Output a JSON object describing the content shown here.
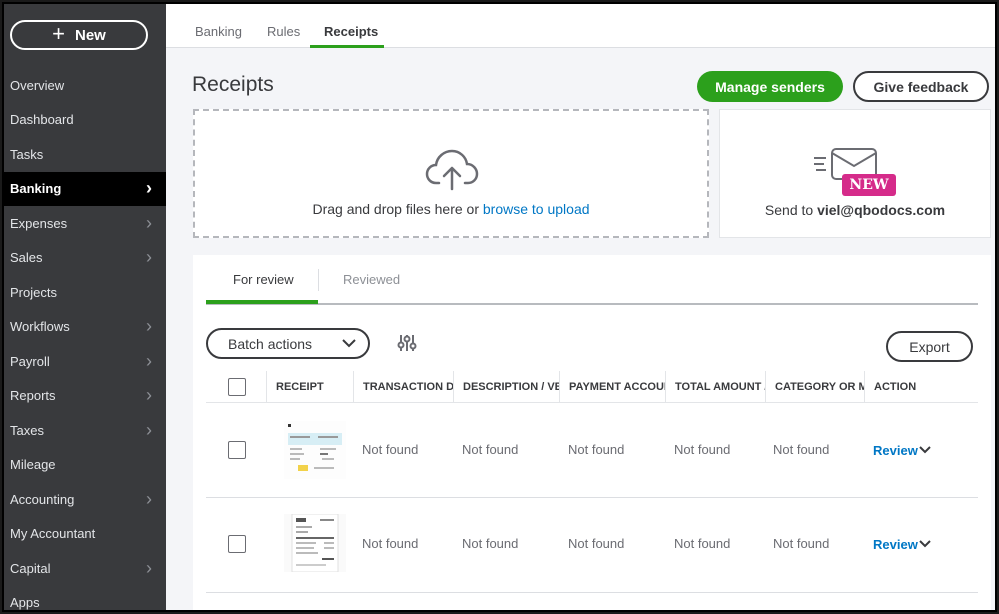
{
  "sidebar": {
    "new_label": "New",
    "items": [
      {
        "label": "Overview",
        "chevron": false
      },
      {
        "label": "Dashboard",
        "chevron": false
      },
      {
        "label": "Tasks",
        "chevron": false
      },
      {
        "label": "Banking",
        "chevron": true,
        "active": true
      },
      {
        "label": "Expenses",
        "chevron": true
      },
      {
        "label": "Sales",
        "chevron": true
      },
      {
        "label": "Projects",
        "chevron": false
      },
      {
        "label": "Workflows",
        "chevron": true
      },
      {
        "label": "Payroll",
        "chevron": true
      },
      {
        "label": "Reports",
        "chevron": true
      },
      {
        "label": "Taxes",
        "chevron": true
      },
      {
        "label": "Mileage",
        "chevron": false
      },
      {
        "label": "Accounting",
        "chevron": true
      },
      {
        "label": "My Accountant",
        "chevron": false
      },
      {
        "label": "Capital",
        "chevron": true
      },
      {
        "label": "Apps",
        "chevron": false
      }
    ]
  },
  "top_tabs": [
    "Banking",
    "Rules",
    "Receipts"
  ],
  "page": {
    "title": "Receipts",
    "manage_senders": "Manage senders",
    "give_feedback": "Give feedback"
  },
  "upload": {
    "text": "Drag and drop files here or ",
    "link": "browse to upload"
  },
  "email_card": {
    "badge": "NEW",
    "send_prefix": "Send to ",
    "email": "viel@qbodocs.com"
  },
  "review_tabs": {
    "for_review": "For review",
    "reviewed": "Reviewed"
  },
  "toolbar": {
    "batch_actions": "Batch actions",
    "export": "Export"
  },
  "table": {
    "columns": [
      "RECEIPT",
      "TRANSACTION DATE",
      "DESCRIPTION / VENDOR",
      "PAYMENT ACCOUNT",
      "TOTAL AMOUNT / TAX",
      "CATEGORY OR MATCH",
      "ACTION"
    ],
    "rows": [
      {
        "date": "Not found",
        "description": "Not found",
        "account": "Not found",
        "amount": "Not found",
        "category": "Not found",
        "action": "Review"
      },
      {
        "date": "Not found",
        "description": "Not found",
        "account": "Not found",
        "amount": "Not found",
        "category": "Not found",
        "action": "Review"
      }
    ]
  },
  "colors": {
    "accent": "#2ca01c",
    "link": "#0077c5",
    "sidebar": "#393a3d",
    "badge": "#d52b8a"
  }
}
